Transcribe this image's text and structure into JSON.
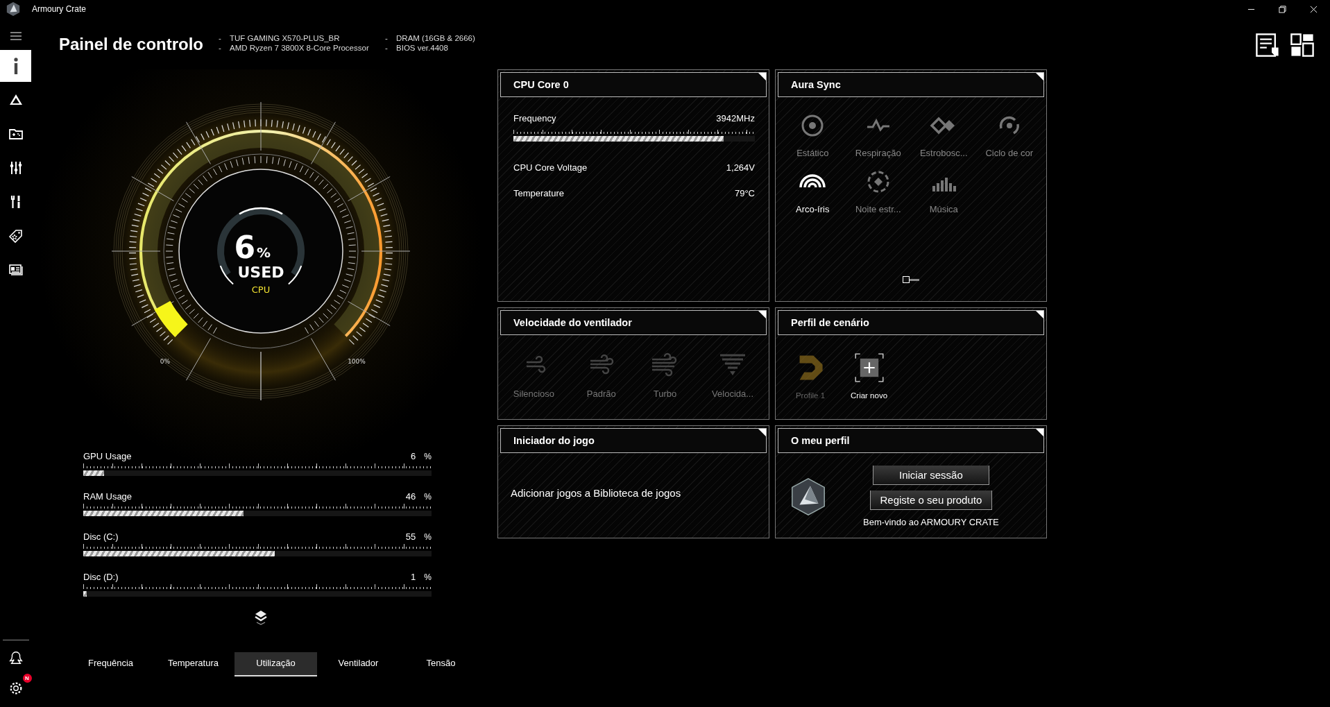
{
  "window": {
    "title": "Armoury Crate"
  },
  "header": {
    "title": "Painel de controlo",
    "info": [
      {
        "bullet": "-",
        "text": "TUF GAMING X570-PLUS_BR"
      },
      {
        "bullet": "-",
        "text": "AMD Ryzen 7 3800X 8-Core Processor"
      },
      {
        "bullet": "-",
        "text": "DRAM (16GB & 2666)"
      },
      {
        "bullet": "-",
        "text": "BIOS ver.4408"
      }
    ]
  },
  "sidebar": {
    "items": [
      {
        "selected": true
      },
      {
        "selected": false
      },
      {
        "selected": false
      },
      {
        "selected": false
      },
      {
        "selected": false
      },
      {
        "selected": false
      },
      {
        "selected": false
      }
    ],
    "settings_badge": "N"
  },
  "gauge": {
    "value": "6",
    "unit": "%",
    "caption": "USED",
    "source": "CPU",
    "min_label": "0%",
    "max_label": "100%",
    "level": 0.06
  },
  "usage": [
    {
      "label": "GPU Usage",
      "value": "6",
      "unit": "%",
      "level": 0.06
    },
    {
      "label": "RAM Usage",
      "value": "46",
      "unit": "%",
      "level": 0.46
    },
    {
      "label": "Disc (C:)",
      "value": "55",
      "unit": "%",
      "level": 0.55
    },
    {
      "label": "Disc (D:)",
      "value": "1",
      "unit": "%",
      "level": 0.01
    }
  ],
  "tabs": [
    {
      "label": "Frequência",
      "selected": false
    },
    {
      "label": "Temperatura",
      "selected": false
    },
    {
      "label": "Utilização",
      "selected": true
    },
    {
      "label": "Ventilador",
      "selected": false
    },
    {
      "label": "Tensão",
      "selected": false
    }
  ],
  "cpu_panel": {
    "title": "CPU Core 0",
    "metrics": [
      {
        "kind": "bar",
        "label": "Frequency",
        "value": "3942MHz",
        "level": 0.87
      },
      {
        "kind": "text",
        "label": "CPU Core Voltage",
        "value": "1,264V"
      },
      {
        "kind": "text",
        "label": "Temperature",
        "value": "79°C"
      }
    ]
  },
  "aura_panel": {
    "title": "Aura Sync",
    "modes": [
      {
        "label": "Estático",
        "selected": false
      },
      {
        "label": "Respiração",
        "selected": false
      },
      {
        "label": "Estrobosc...",
        "selected": false
      },
      {
        "label": "Ciclo de cor",
        "selected": false
      },
      {
        "label": "Arco-íris",
        "selected": true
      },
      {
        "label": "Noite estr...",
        "selected": false
      },
      {
        "label": "Música",
        "selected": false
      }
    ],
    "pages": [
      {
        "selected": true
      },
      {
        "selected": false
      }
    ]
  },
  "fan_panel": {
    "title": "Velocidade do ventilador",
    "modes": [
      {
        "label": "Silencioso",
        "disabled": true
      },
      {
        "label": "Padrão",
        "disabled": true
      },
      {
        "label": "Turbo",
        "disabled": true
      },
      {
        "label": "Velocida...",
        "disabled": true
      }
    ]
  },
  "scenario_panel": {
    "title": "Perfil de cenário",
    "profiles": [
      {
        "kind": "profile",
        "label": "Profile 1",
        "disabled": true
      },
      {
        "kind": "create",
        "label": "Criar novo",
        "disabled": false
      }
    ]
  },
  "launcher_panel": {
    "title": "Iniciador do jogo",
    "message": "Adicionar jogos a Biblioteca de jogos"
  },
  "profile_panel": {
    "title": "O meu perfil",
    "buttons": [
      "Iniciar sessão",
      "Registe o seu produto"
    ],
    "welcome": "Bem-vindo ao ARMOURY CRATE"
  }
}
